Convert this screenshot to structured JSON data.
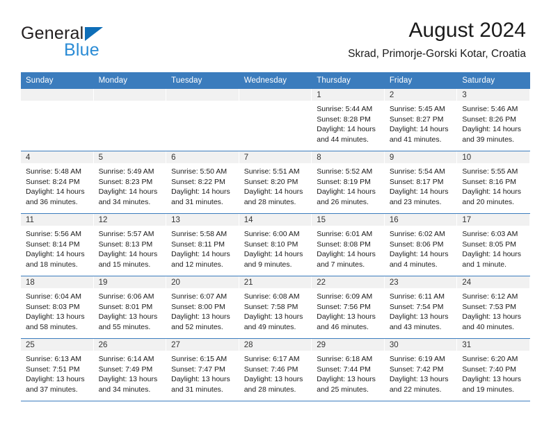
{
  "brand": {
    "name_part1": "General",
    "name_part2": "Blue",
    "triangle_icon": "triangle-logo-icon",
    "colors": {
      "dark": "#231f20",
      "blue": "#2a8bd5",
      "triangle": "#0e6eb8"
    }
  },
  "header": {
    "title": "August 2024",
    "subtitle": "Skrad, Primorje-Gorski Kotar, Croatia"
  },
  "theme": {
    "header_blue": "#3b7cbd",
    "daynum_band": "#f1f1f1",
    "text": "#1a1a1a"
  },
  "weekdays": [
    "Sunday",
    "Monday",
    "Tuesday",
    "Wednesday",
    "Thursday",
    "Friday",
    "Saturday"
  ],
  "weeks": [
    [
      {
        "day": "",
        "sunrise": "",
        "sunset": "",
        "daylight1": "",
        "daylight2": "",
        "empty": true
      },
      {
        "day": "",
        "sunrise": "",
        "sunset": "",
        "daylight1": "",
        "daylight2": "",
        "empty": true
      },
      {
        "day": "",
        "sunrise": "",
        "sunset": "",
        "daylight1": "",
        "daylight2": "",
        "empty": true
      },
      {
        "day": "",
        "sunrise": "",
        "sunset": "",
        "daylight1": "",
        "daylight2": "",
        "empty": true
      },
      {
        "day": "1",
        "sunrise": "Sunrise: 5:44 AM",
        "sunset": "Sunset: 8:28 PM",
        "daylight1": "Daylight: 14 hours",
        "daylight2": "and 44 minutes."
      },
      {
        "day": "2",
        "sunrise": "Sunrise: 5:45 AM",
        "sunset": "Sunset: 8:27 PM",
        "daylight1": "Daylight: 14 hours",
        "daylight2": "and 41 minutes."
      },
      {
        "day": "3",
        "sunrise": "Sunrise: 5:46 AM",
        "sunset": "Sunset: 8:26 PM",
        "daylight1": "Daylight: 14 hours",
        "daylight2": "and 39 minutes."
      }
    ],
    [
      {
        "day": "4",
        "sunrise": "Sunrise: 5:48 AM",
        "sunset": "Sunset: 8:24 PM",
        "daylight1": "Daylight: 14 hours",
        "daylight2": "and 36 minutes."
      },
      {
        "day": "5",
        "sunrise": "Sunrise: 5:49 AM",
        "sunset": "Sunset: 8:23 PM",
        "daylight1": "Daylight: 14 hours",
        "daylight2": "and 34 minutes."
      },
      {
        "day": "6",
        "sunrise": "Sunrise: 5:50 AM",
        "sunset": "Sunset: 8:22 PM",
        "daylight1": "Daylight: 14 hours",
        "daylight2": "and 31 minutes."
      },
      {
        "day": "7",
        "sunrise": "Sunrise: 5:51 AM",
        "sunset": "Sunset: 8:20 PM",
        "daylight1": "Daylight: 14 hours",
        "daylight2": "and 28 minutes."
      },
      {
        "day": "8",
        "sunrise": "Sunrise: 5:52 AM",
        "sunset": "Sunset: 8:19 PM",
        "daylight1": "Daylight: 14 hours",
        "daylight2": "and 26 minutes."
      },
      {
        "day": "9",
        "sunrise": "Sunrise: 5:54 AM",
        "sunset": "Sunset: 8:17 PM",
        "daylight1": "Daylight: 14 hours",
        "daylight2": "and 23 minutes."
      },
      {
        "day": "10",
        "sunrise": "Sunrise: 5:55 AM",
        "sunset": "Sunset: 8:16 PM",
        "daylight1": "Daylight: 14 hours",
        "daylight2": "and 20 minutes."
      }
    ],
    [
      {
        "day": "11",
        "sunrise": "Sunrise: 5:56 AM",
        "sunset": "Sunset: 8:14 PM",
        "daylight1": "Daylight: 14 hours",
        "daylight2": "and 18 minutes."
      },
      {
        "day": "12",
        "sunrise": "Sunrise: 5:57 AM",
        "sunset": "Sunset: 8:13 PM",
        "daylight1": "Daylight: 14 hours",
        "daylight2": "and 15 minutes."
      },
      {
        "day": "13",
        "sunrise": "Sunrise: 5:58 AM",
        "sunset": "Sunset: 8:11 PM",
        "daylight1": "Daylight: 14 hours",
        "daylight2": "and 12 minutes."
      },
      {
        "day": "14",
        "sunrise": "Sunrise: 6:00 AM",
        "sunset": "Sunset: 8:10 PM",
        "daylight1": "Daylight: 14 hours",
        "daylight2": "and 9 minutes."
      },
      {
        "day": "15",
        "sunrise": "Sunrise: 6:01 AM",
        "sunset": "Sunset: 8:08 PM",
        "daylight1": "Daylight: 14 hours",
        "daylight2": "and 7 minutes."
      },
      {
        "day": "16",
        "sunrise": "Sunrise: 6:02 AM",
        "sunset": "Sunset: 8:06 PM",
        "daylight1": "Daylight: 14 hours",
        "daylight2": "and 4 minutes."
      },
      {
        "day": "17",
        "sunrise": "Sunrise: 6:03 AM",
        "sunset": "Sunset: 8:05 PM",
        "daylight1": "Daylight: 14 hours",
        "daylight2": "and 1 minute."
      }
    ],
    [
      {
        "day": "18",
        "sunrise": "Sunrise: 6:04 AM",
        "sunset": "Sunset: 8:03 PM",
        "daylight1": "Daylight: 13 hours",
        "daylight2": "and 58 minutes."
      },
      {
        "day": "19",
        "sunrise": "Sunrise: 6:06 AM",
        "sunset": "Sunset: 8:01 PM",
        "daylight1": "Daylight: 13 hours",
        "daylight2": "and 55 minutes."
      },
      {
        "day": "20",
        "sunrise": "Sunrise: 6:07 AM",
        "sunset": "Sunset: 8:00 PM",
        "daylight1": "Daylight: 13 hours",
        "daylight2": "and 52 minutes."
      },
      {
        "day": "21",
        "sunrise": "Sunrise: 6:08 AM",
        "sunset": "Sunset: 7:58 PM",
        "daylight1": "Daylight: 13 hours",
        "daylight2": "and 49 minutes."
      },
      {
        "day": "22",
        "sunrise": "Sunrise: 6:09 AM",
        "sunset": "Sunset: 7:56 PM",
        "daylight1": "Daylight: 13 hours",
        "daylight2": "and 46 minutes."
      },
      {
        "day": "23",
        "sunrise": "Sunrise: 6:11 AM",
        "sunset": "Sunset: 7:54 PM",
        "daylight1": "Daylight: 13 hours",
        "daylight2": "and 43 minutes."
      },
      {
        "day": "24",
        "sunrise": "Sunrise: 6:12 AM",
        "sunset": "Sunset: 7:53 PM",
        "daylight1": "Daylight: 13 hours",
        "daylight2": "and 40 minutes."
      }
    ],
    [
      {
        "day": "25",
        "sunrise": "Sunrise: 6:13 AM",
        "sunset": "Sunset: 7:51 PM",
        "daylight1": "Daylight: 13 hours",
        "daylight2": "and 37 minutes."
      },
      {
        "day": "26",
        "sunrise": "Sunrise: 6:14 AM",
        "sunset": "Sunset: 7:49 PM",
        "daylight1": "Daylight: 13 hours",
        "daylight2": "and 34 minutes."
      },
      {
        "day": "27",
        "sunrise": "Sunrise: 6:15 AM",
        "sunset": "Sunset: 7:47 PM",
        "daylight1": "Daylight: 13 hours",
        "daylight2": "and 31 minutes."
      },
      {
        "day": "28",
        "sunrise": "Sunrise: 6:17 AM",
        "sunset": "Sunset: 7:46 PM",
        "daylight1": "Daylight: 13 hours",
        "daylight2": "and 28 minutes."
      },
      {
        "day": "29",
        "sunrise": "Sunrise: 6:18 AM",
        "sunset": "Sunset: 7:44 PM",
        "daylight1": "Daylight: 13 hours",
        "daylight2": "and 25 minutes."
      },
      {
        "day": "30",
        "sunrise": "Sunrise: 6:19 AM",
        "sunset": "Sunset: 7:42 PM",
        "daylight1": "Daylight: 13 hours",
        "daylight2": "and 22 minutes."
      },
      {
        "day": "31",
        "sunrise": "Sunrise: 6:20 AM",
        "sunset": "Sunset: 7:40 PM",
        "daylight1": "Daylight: 13 hours",
        "daylight2": "and 19 minutes."
      }
    ]
  ]
}
